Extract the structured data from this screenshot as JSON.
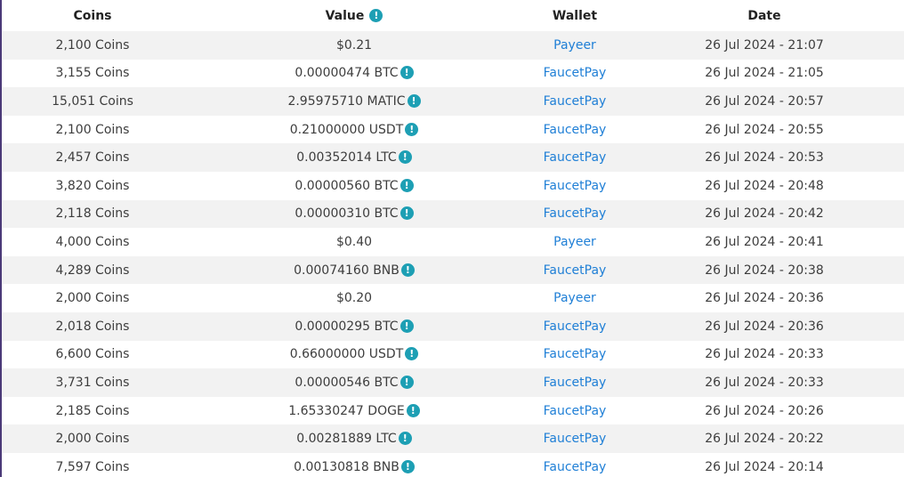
{
  "table": {
    "headers": {
      "coins": "Coins",
      "value": "Value",
      "wallet": "Wallet",
      "date": "Date"
    },
    "info_icon": "info-icon",
    "rows": [
      {
        "coins": "2,100 Coins",
        "value": "$0.21",
        "has_info": false,
        "wallet": "Payeer",
        "date": "26 Jul 2024 - 21:07"
      },
      {
        "coins": "3,155 Coins",
        "value": "0.00000474 BTC",
        "has_info": true,
        "wallet": "FaucetPay",
        "date": "26 Jul 2024 - 21:05"
      },
      {
        "coins": "15,051 Coins",
        "value": "2.95975710 MATIC",
        "has_info": true,
        "wallet": "FaucetPay",
        "date": "26 Jul 2024 - 20:57"
      },
      {
        "coins": "2,100 Coins",
        "value": "0.21000000 USDT",
        "has_info": true,
        "wallet": "FaucetPay",
        "date": "26 Jul 2024 - 20:55"
      },
      {
        "coins": "2,457 Coins",
        "value": "0.00352014 LTC",
        "has_info": true,
        "wallet": "FaucetPay",
        "date": "26 Jul 2024 - 20:53"
      },
      {
        "coins": "3,820 Coins",
        "value": "0.00000560 BTC",
        "has_info": true,
        "wallet": "FaucetPay",
        "date": "26 Jul 2024 - 20:48"
      },
      {
        "coins": "2,118 Coins",
        "value": "0.00000310 BTC",
        "has_info": true,
        "wallet": "FaucetPay",
        "date": "26 Jul 2024 - 20:42"
      },
      {
        "coins": "4,000 Coins",
        "value": "$0.40",
        "has_info": false,
        "wallet": "Payeer",
        "date": "26 Jul 2024 - 20:41"
      },
      {
        "coins": "4,289 Coins",
        "value": "0.00074160 BNB",
        "has_info": true,
        "wallet": "FaucetPay",
        "date": "26 Jul 2024 - 20:38"
      },
      {
        "coins": "2,000 Coins",
        "value": "$0.20",
        "has_info": false,
        "wallet": "Payeer",
        "date": "26 Jul 2024 - 20:36"
      },
      {
        "coins": "2,018 Coins",
        "value": "0.00000295 BTC",
        "has_info": true,
        "wallet": "FaucetPay",
        "date": "26 Jul 2024 - 20:36"
      },
      {
        "coins": "6,600 Coins",
        "value": "0.66000000 USDT",
        "has_info": true,
        "wallet": "FaucetPay",
        "date": "26 Jul 2024 - 20:33"
      },
      {
        "coins": "3,731 Coins",
        "value": "0.00000546 BTC",
        "has_info": true,
        "wallet": "FaucetPay",
        "date": "26 Jul 2024 - 20:33"
      },
      {
        "coins": "2,185 Coins",
        "value": "1.65330247 DOGE",
        "has_info": true,
        "wallet": "FaucetPay",
        "date": "26 Jul 2024 - 20:26"
      },
      {
        "coins": "2,000 Coins",
        "value": "0.00281889 LTC",
        "has_info": true,
        "wallet": "FaucetPay",
        "date": "26 Jul 2024 - 20:22"
      },
      {
        "coins": "7,597 Coins",
        "value": "0.00130818 BNB",
        "has_info": true,
        "wallet": "FaucetPay",
        "date": "26 Jul 2024 - 20:14"
      }
    ]
  },
  "colors": {
    "link": "#1f7fd6",
    "info_badge": "#1d9fb4",
    "row_stripe": "#f2f2f2",
    "frame": "#4b3a78"
  }
}
